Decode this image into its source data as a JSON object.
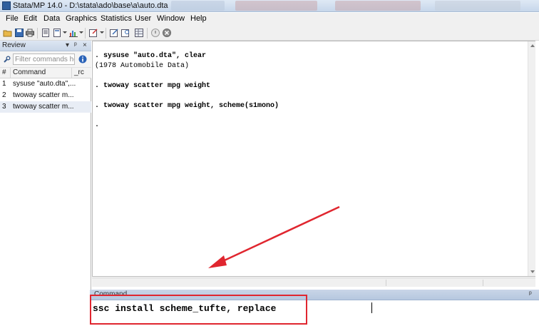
{
  "window": {
    "title": "Stata/MP 14.0 - D:\\stata\\ado\\base\\a\\auto.dta"
  },
  "menu": [
    "File",
    "Edit",
    "Data",
    "Graphics",
    "Statistics",
    "User",
    "Window",
    "Help"
  ],
  "toolbar": {
    "icons": [
      "open-icon",
      "save-icon",
      "print-icon",
      "log-icon",
      "viewer-icon",
      "graph-icon",
      "do-file-editor-icon",
      "data-editor-icon",
      "data-browser-icon",
      "variables-manager-icon",
      "more-icon",
      "break-icon"
    ]
  },
  "review": {
    "title": "Review",
    "filter_placeholder": "Filter commands he",
    "columns": {
      "num": "#",
      "command": "Command",
      "rc": "_rc"
    },
    "rows": [
      {
        "num": "1",
        "command": "sysuse \"auto.dta\",..."
      },
      {
        "num": "2",
        "command": "twoway scatter m..."
      },
      {
        "num": "3",
        "command": "twoway scatter m..."
      }
    ]
  },
  "results": {
    "lines": [
      ". sysuse \"auto.dta\", clear",
      "(1978 Automobile Data)",
      ". twoway scatter mpg weight",
      ". twoway scatter mpg weight, scheme(s1mono)",
      "."
    ]
  },
  "command_window": {
    "title": "Command",
    "value": "ssc install scheme_tufte, replace"
  },
  "colors": {
    "highlight": "#e0262f",
    "panel_header": "#c9d6e8"
  }
}
